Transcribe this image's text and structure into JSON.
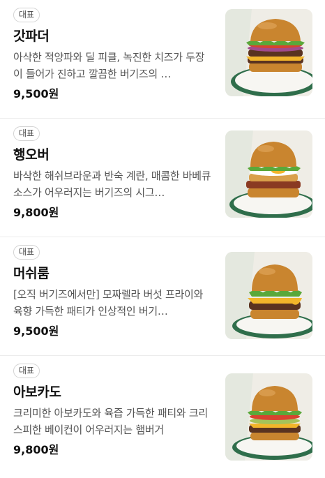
{
  "menu": {
    "items": [
      {
        "badge": "대표",
        "name": "갓파더",
        "description": "아삭한 적양파와 딜 피클, 녹진한 치즈가 두장이 들어가 진하고 깔끔한 버기즈의 …",
        "price": "9,500원",
        "image_icon": "burger-photo"
      },
      {
        "badge": "대표",
        "name": "행오버",
        "description": "바삭한 해쉬브라운과 반숙 계란, 매콤한 바베큐 소스가 어우러지는 버기즈의 시그…",
        "price": "9,800원",
        "image_icon": "burger-photo"
      },
      {
        "badge": "대표",
        "name": "머쉬룸",
        "description": "[오직 버기즈에서만] 모짜렐라 버섯 프라이와 육향 가득한 패티가 인상적인 버기…",
        "price": "9,500원",
        "image_icon": "burger-photo"
      },
      {
        "badge": "대표",
        "name": "아보카도",
        "description": "크리미한 아보카도와 육즙 가득한 패티와 크리스피한 베이컨이 어우러지는 햄버거",
        "price": "9,800원",
        "image_icon": "burger-photo"
      }
    ]
  },
  "colors": {
    "plate_rim": "#2f6e4b",
    "bun": "#c9852f",
    "lettuce": "#5aa83a",
    "patty": "#5a3320",
    "cheese": "#f2b52a",
    "tomato": "#d8432f",
    "onion": "#a14a8c"
  }
}
